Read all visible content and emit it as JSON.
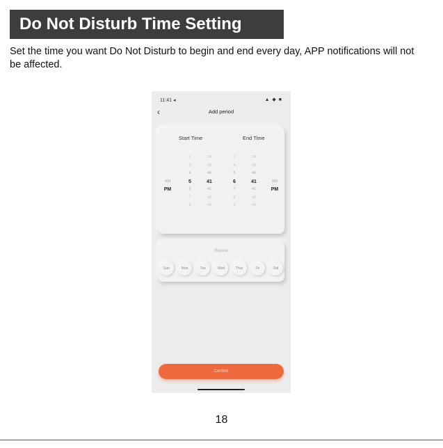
{
  "heading": "Do Not Disturb Time Setting",
  "intro": "Set the time you want Do Not Disturb to begin and end every day, APP notifications will not be affected.",
  "phone": {
    "status_time": "11:41 ◂",
    "status_icons": "▲ ◆ ■",
    "back_icon": "chevron-left-icon",
    "nav_title": "Add period",
    "time_card": {
      "start_label": "Start Time",
      "end_label": "End Time",
      "wheels": [
        {
          "name": "start-ampm",
          "items": [
            "",
            "",
            "",
            "AM",
            "PM",
            "",
            "",
            ""
          ],
          "selected": 4
        },
        {
          "name": "start-hour",
          "items": [
            "2",
            "3",
            "4",
            "5",
            "6",
            "7",
            "8"
          ],
          "selected": 3
        },
        {
          "name": "start-minute",
          "items": [
            "38",
            "39",
            "40",
            "41",
            "42",
            "43",
            "44"
          ],
          "selected": 3
        },
        {
          "name": "end-hour",
          "items": [
            "3",
            "4",
            "5",
            "6",
            "7",
            "8",
            "9"
          ],
          "selected": 3
        },
        {
          "name": "end-minute",
          "items": [
            "38",
            "39",
            "40",
            "41",
            "42",
            "43",
            "44"
          ],
          "selected": 3
        },
        {
          "name": "end-ampm",
          "items": [
            "",
            "",
            "",
            "AM",
            "PM",
            "",
            "",
            ""
          ],
          "selected": 4
        }
      ]
    },
    "repeat_card": {
      "title": "Repeat",
      "days": [
        "Sun",
        "Mon",
        "Tue",
        "Wed",
        "Thur",
        "Fri",
        "Sat"
      ]
    },
    "confirm_label": "Confirm"
  },
  "page_number": "18"
}
